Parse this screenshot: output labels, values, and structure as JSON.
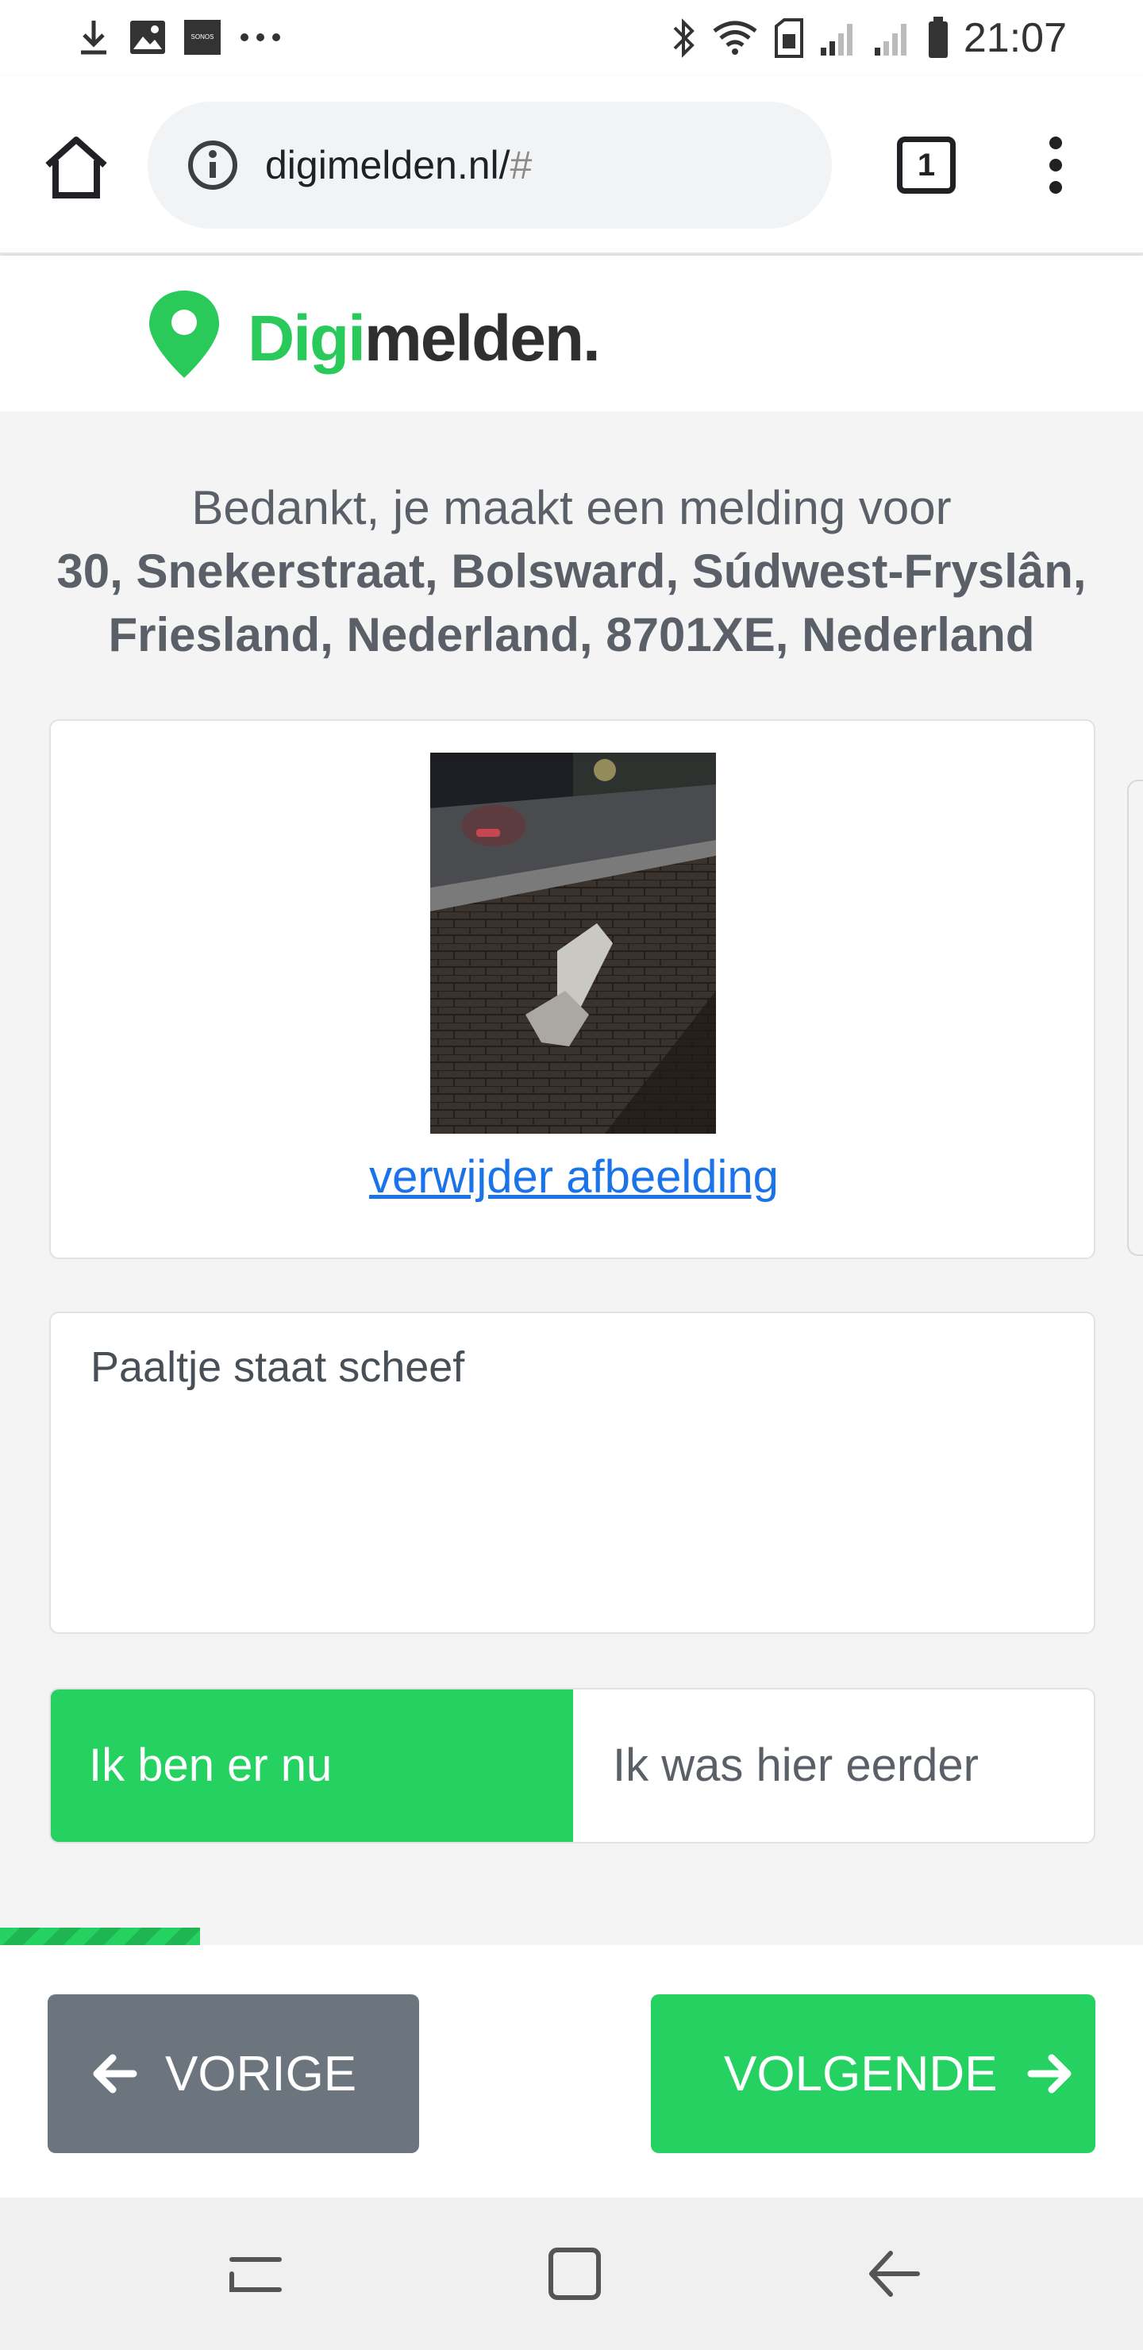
{
  "status_bar": {
    "time": "21:07",
    "left_icons": [
      "download-icon",
      "image-icon",
      "sonos-icon",
      "more-icon"
    ],
    "sonos_text": "SONOS",
    "right_icons": [
      "bluetooth-icon",
      "wifi-icon",
      "sim-icon",
      "signal-icon",
      "signal-icon",
      "battery-icon"
    ]
  },
  "browser": {
    "url_host": "digimelden.nl/",
    "url_hash": "#",
    "tab_count": "1"
  },
  "site": {
    "logo_part1": "Digi",
    "logo_part2": "melden."
  },
  "main": {
    "intro_text": "Bedankt, je maakt een melding voor",
    "address": "30, Snekerstraat, Bolsward, Súdwest-Fryslân, Friesland, Nederland, 8701XE, Nederland",
    "remove_image_link": "verwijder afbeelding",
    "description_value": "Paaltje staat scheef",
    "toggle_now": "Ik ben er nu",
    "toggle_earlier": "Ik was hier eerder",
    "toggle_selected": "Ik ben er nu"
  },
  "progress": {
    "value": 0.175
  },
  "footer": {
    "prev_label": "VORIGE",
    "next_label": "VOLGENDE"
  },
  "colors": {
    "brand_green": "#25d160",
    "prev_button_gray": "#6c757d",
    "link_blue": "#1a73e8"
  }
}
